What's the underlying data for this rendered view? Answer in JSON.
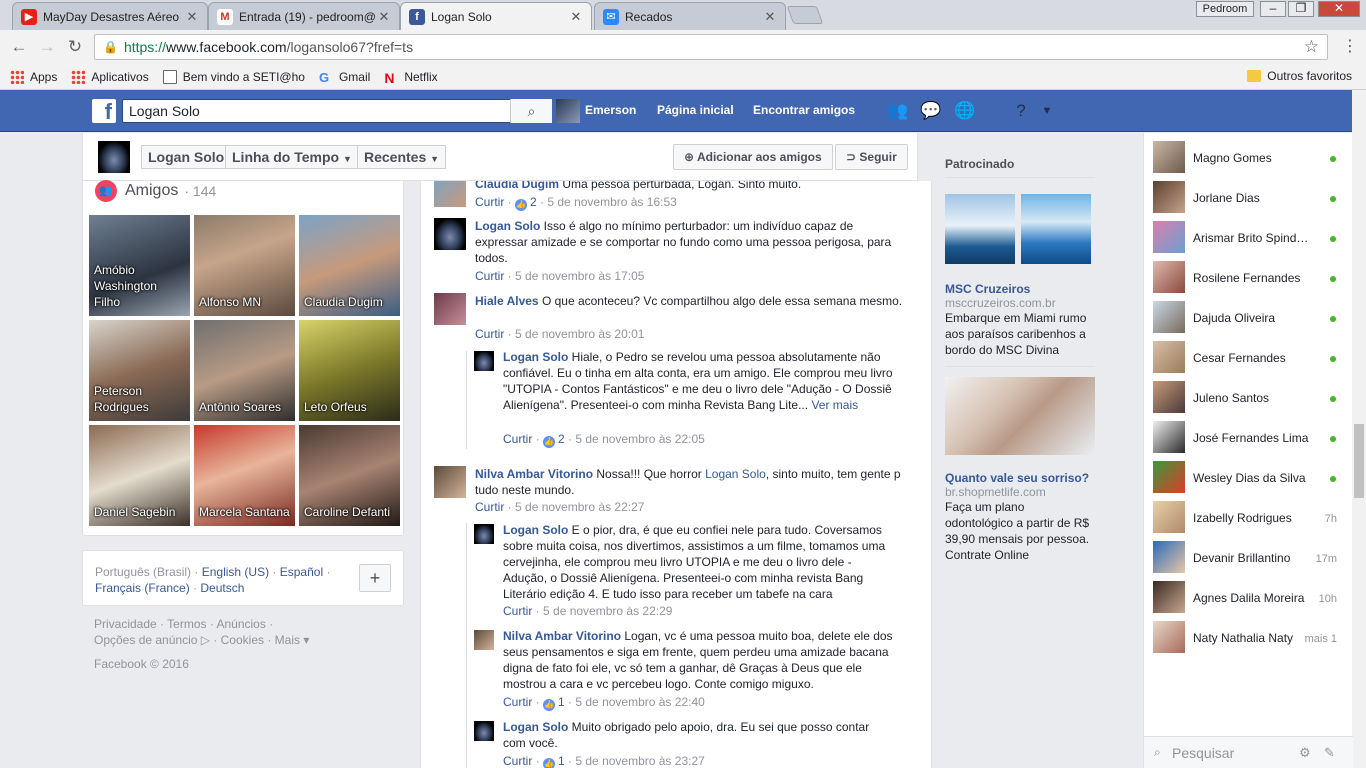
{
  "browser": {
    "tabs": [
      {
        "title": "MayDay Desastres Aéreo",
        "icon": "youtube-icon",
        "color": "#e62117"
      },
      {
        "title": "Entrada (19) - pedroom@",
        "icon": "gmail-icon",
        "color": "#d93025"
      },
      {
        "title": "Logan Solo",
        "icon": "facebook-icon",
        "color": "#3b5998"
      },
      {
        "title": "Recados",
        "icon": "messenger-icon",
        "color": "#2d88ff"
      }
    ],
    "user": "Pedroom",
    "url_secure": "https://",
    "url_host": "www.facebook.com",
    "url_path": "/logansolo67?fref=ts",
    "bookmarks": [
      "Apps",
      "Aplicativos",
      "Bem vindo a SETI@ho",
      "Gmail",
      "Netflix"
    ],
    "other_bookmarks": "Outros favoritos"
  },
  "fb": {
    "search_value": "Logan Solo",
    "user_name": "Emerson",
    "nav_home": "Página inicial",
    "nav_find": "Encontrar amigos",
    "accent": "#4267b2"
  },
  "profile": {
    "name": "Logan Solo",
    "timeline": "Linha do Tempo",
    "recent": "Recentes",
    "add_friend": "Adicionar aos amigos",
    "follow": "Seguir"
  },
  "friends": {
    "title": "Amigos",
    "count": "· 144",
    "list": [
      {
        "name": "Amóbio Washington Filho"
      },
      {
        "name": "Alfonso MN"
      },
      {
        "name": "Claudia Dugim"
      },
      {
        "name": "Peterson Rodrigues"
      },
      {
        "name": "Antônio Soares"
      },
      {
        "name": "Leto Orfeus"
      },
      {
        "name": "Daniel Sagebin"
      },
      {
        "name": "Marcela Santana"
      },
      {
        "name": "Caroline Defanti"
      }
    ]
  },
  "languages": {
    "current": "Português (Brasil)",
    "sep": " · ",
    "options": [
      "English (US)",
      "Español",
      "Français (France)",
      "Deutsch"
    ]
  },
  "footer": {
    "line1": "Privacidade · Termos · Anúncios ·",
    "line2": "Opções de anúncio ▷ · Cookies · Mais ▾",
    "copyright": "Facebook © 2016"
  },
  "comments": [
    {
      "author": "Claudia Dugim",
      "text": "Uma pessoa perturbada, Logan. Sinto muito.",
      "action": "Curtir",
      "likes": "2",
      "time": "5 de novembro às 16:53"
    },
    {
      "author": "Logan Solo",
      "text": "Isso é algo no mínimo perturbador: um indivíduo capaz de expressar amizade e se comportar no fundo como uma pessoa perigosa, para todos.",
      "action": "Curtir",
      "likes": "",
      "time": "5 de novembro às 17:05"
    },
    {
      "author": "Hiale Alves",
      "text": "O que aconteceu? Vc compartilhou algo dele essa semana mesmo.",
      "action": "Curtir",
      "likes": "",
      "time": "5 de novembro às 20:01"
    },
    {
      "author": "Logan Solo",
      "text": "Hiale, o Pedro se revelou uma pessoa absolutamente não confiável. Eu o tinha em alta conta, era um amigo. Ele comprou meu livro \"UTOPIA - Contos Fantásticos\" e me deu o livro dele \"Adução - O Dossiê Alienígena\". Presenteei-o com minha Revista Bang Lite...",
      "more": "Ver mais",
      "action": "Curtir",
      "likes": "2",
      "time": "5 de novembro às 22:05"
    },
    {
      "author": "Nilva Ambar Vitorino",
      "text": "Nossa!!! Que horror",
      "mention": "Logan Solo",
      "text2": ", sinto muito, tem gente p tudo neste mundo.",
      "action": "Curtir",
      "likes": "",
      "time": "5 de novembro às 22:27"
    },
    {
      "author": "Logan Solo",
      "text": "E o pior, dra, é que eu confiei nele para tudo. Coversamos sobre muita coisa, nos divertimos, assistimos a um filme, tomamos uma cervejinha, ele comprou meu livro UTOPIA e me deu o livro dele - Adução, o Dossiê Alienígena. Presenteei-o com minha revista Bang Literário edição 4. E tudo isso para receber um tabefe na cara",
      "action": "Curtir",
      "likes": "",
      "time": "5 de novembro às 22:29"
    },
    {
      "author": "Nilva Ambar Vitorino",
      "text": "Logan, vc é uma pessoa muito boa, delete ele dos seus pensamentos e siga em frente, quem perdeu uma amizade bacana digna de fato foi ele, vc só tem a ganhar, dê Graças à Deus que ele mostrou a cara e vc percebeu logo. Conte comigo miguxo.",
      "action": "Curtir",
      "likes": "1",
      "time": "5 de novembro às 22:40"
    },
    {
      "author": "Logan Solo",
      "text": "Muito obrigado pelo apoio, dra. Eu sei que posso contar com você.",
      "action": "Curtir",
      "likes": "1",
      "time": "5 de novembro às 23:27"
    }
  ],
  "ads": {
    "title": "Patrocinado",
    "ad1": {
      "title": "MSC Cruzeiros",
      "url": "msccruzeiros.com.br",
      "text": "Embarque em Miami rumo aos paraísos caribenhos a bordo do MSC Divina"
    },
    "ad2": {
      "title": "Quanto vale seu sorriso?",
      "url": "br.shopmetlife.com",
      "text": "Faça um plano odontológico a partir de R$ 39,90 mensais por pessoa. Contrate Online"
    }
  },
  "chat": {
    "contacts": [
      {
        "name": "Magno Gomes",
        "status": ""
      },
      {
        "name": "Jorlane Dias",
        "status": ""
      },
      {
        "name": "Arismar Brito Spindola",
        "status": ""
      },
      {
        "name": "Rosilene Fernandes",
        "status": ""
      },
      {
        "name": "Dajuda Oliveira",
        "status": ""
      },
      {
        "name": "Cesar Fernandes",
        "status": ""
      },
      {
        "name": "Juleno Santos",
        "status": ""
      },
      {
        "name": "José Fernandes Lima",
        "status": ""
      },
      {
        "name": "Wesley Dias da Silva",
        "status": ""
      },
      {
        "name": "Izabelly Rodrigues",
        "status": "7h"
      },
      {
        "name": "Devanir Brillantino",
        "status": "17m"
      },
      {
        "name": "Agnes Dalila Moreira",
        "status": "10h"
      },
      {
        "name": "Naty Nathalia Naty",
        "status": "mais 1"
      }
    ],
    "search_placeholder": "Pesquisar"
  }
}
